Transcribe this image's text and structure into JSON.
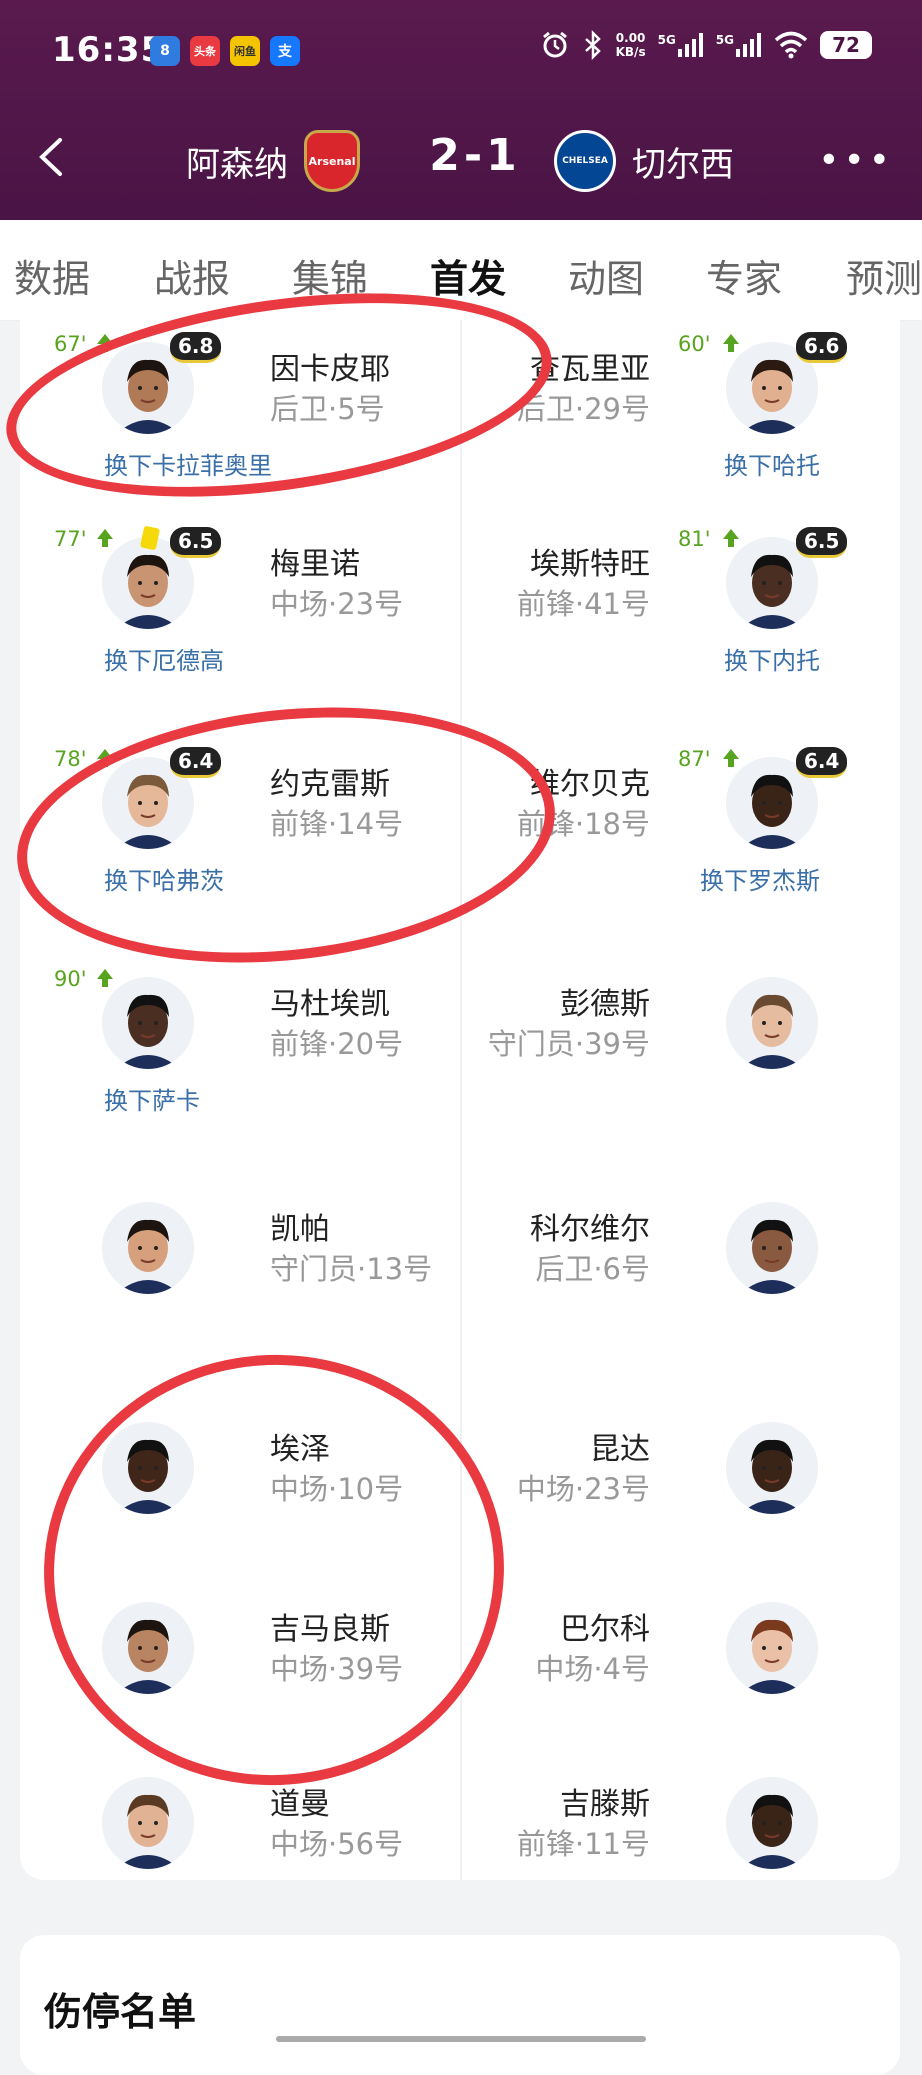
{
  "status_bar": {
    "time": "16:35",
    "apps": [
      {
        "label": "8",
        "color": "#2f7be0"
      },
      {
        "label": "头条",
        "color": "#e83a40"
      },
      {
        "label": "闲鱼",
        "color": "#f5c400"
      },
      {
        "label": "支",
        "color": "#1677ff"
      }
    ],
    "net_speed_value": "0.00",
    "net_speed_unit": "KB/s",
    "signal_1": "5G",
    "signal_2": "5G",
    "battery": "72"
  },
  "match": {
    "home_team": "阿森纳",
    "home_crest": "Arsenal",
    "away_team": "切尔西",
    "away_crest": "CHELSEA",
    "score": "2-1"
  },
  "tabs": [
    {
      "label": "数据",
      "active": false
    },
    {
      "label": "战报",
      "active": false
    },
    {
      "label": "集锦",
      "active": false
    },
    {
      "label": "首发",
      "active": true
    },
    {
      "label": "动图",
      "active": false
    },
    {
      "label": "专家",
      "active": false
    },
    {
      "label": "预测",
      "active": false
    }
  ],
  "home_players": [
    {
      "name": "因卡皮耶",
      "position": "后卫·5号",
      "rating": "6.8",
      "sub_minute": "67'",
      "sub_for": "换下卡拉菲奥里",
      "yellow": false,
      "skin": "#b07a56",
      "hair": "#1d1410"
    },
    {
      "name": "梅里诺",
      "position": "中场·23号",
      "rating": "6.5",
      "sub_minute": "77'",
      "sub_for": "换下厄德高",
      "yellow": true,
      "skin": "#c99472",
      "hair": "#1d1410"
    },
    {
      "name": "约克雷斯",
      "position": "前锋·14号",
      "rating": "6.4",
      "sub_minute": "78'",
      "sub_for": "换下哈弗茨",
      "yellow": false,
      "skin": "#e6b89a",
      "hair": "#7a5a3a"
    },
    {
      "name": "马杜埃凯",
      "position": "前锋·20号",
      "rating": "",
      "sub_minute": "90'",
      "sub_for": "换下萨卡",
      "yellow": false,
      "skin": "#4a2e22",
      "hair": "#111111"
    },
    {
      "name": "凯帕",
      "position": "守门员·13号",
      "rating": "",
      "sub_minute": "",
      "sub_for": "",
      "yellow": false,
      "skin": "#d6a07c",
      "hair": "#1d1410"
    },
    {
      "name": "埃泽",
      "position": "中场·10号",
      "rating": "",
      "sub_minute": "",
      "sub_for": "",
      "yellow": false,
      "skin": "#3f2619",
      "hair": "#111111"
    },
    {
      "name": "吉马良斯",
      "position": "中场·39号",
      "rating": "",
      "sub_minute": "",
      "sub_for": "",
      "yellow": false,
      "skin": "#b98462",
      "hair": "#1d1410"
    },
    {
      "name": "道曼",
      "position": "中场·56号",
      "rating": "",
      "sub_minute": "",
      "sub_for": "",
      "yellow": false,
      "skin": "#e2b294",
      "hair": "#5a3a22"
    }
  ],
  "away_players": [
    {
      "name": "查瓦里亚",
      "position": "后卫·29号",
      "rating": "6.6",
      "sub_minute": "60'",
      "sub_for": "换下哈托",
      "skin": "#e0b090",
      "hair": "#2a1a12"
    },
    {
      "name": "埃斯特旺",
      "position": "前锋·41号",
      "rating": "6.5",
      "sub_minute": "81'",
      "sub_for": "换下内托",
      "skin": "#4a2e22",
      "hair": "#111111"
    },
    {
      "name": "维尔贝克",
      "position": "前锋·18号",
      "rating": "6.4",
      "sub_minute": "87'",
      "sub_for": "换下罗杰斯",
      "skin": "#3a2418",
      "hair": "#111111"
    },
    {
      "name": "彭德斯",
      "position": "守门员·39号",
      "rating": "",
      "sub_minute": "",
      "sub_for": "",
      "skin": "#e6bca0",
      "hair": "#6a4a30"
    },
    {
      "name": "科尔维尔",
      "position": "后卫·6号",
      "rating": "",
      "sub_minute": "",
      "sub_for": "",
      "skin": "#8a5a40",
      "hair": "#111111"
    },
    {
      "name": "昆达",
      "position": "中场·23号",
      "rating": "",
      "sub_minute": "",
      "sub_for": "",
      "skin": "#3a2418",
      "hair": "#111111"
    },
    {
      "name": "巴尔科",
      "position": "中场·4号",
      "rating": "",
      "sub_minute": "",
      "sub_for": "",
      "skin": "#eac0a6",
      "hair": "#7a3a1e"
    },
    {
      "name": "吉滕斯",
      "position": "前锋·11号",
      "rating": "",
      "sub_minute": "",
      "sub_for": "",
      "skin": "#3a2418",
      "hair": "#111111"
    }
  ],
  "injury_section_title": "伤停名单",
  "colors": {
    "header_bg": "#4a1445",
    "annotation_red": "#e83a40",
    "sub_green": "#58a31f",
    "link_blue": "#3a6fa8"
  }
}
